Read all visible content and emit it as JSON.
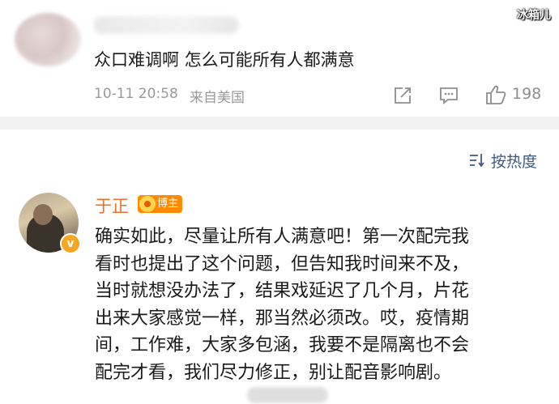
{
  "watermark": {
    "corner_text": "冰箱儿"
  },
  "comment1": {
    "text": "众口难调啊 怎么可能所有人都满意",
    "time": "10-11 20:58",
    "source": "来自美国",
    "like_count": "198"
  },
  "sort": {
    "label": "按热度"
  },
  "reply": {
    "author": "于正",
    "badge": "博主",
    "verified_mark": "v",
    "lines": [
      "确实如此，尽量让所有人满意吧！第一次配完我",
      "看时也提出了这个问题，但告知我时间来不及，",
      "当时就想没办法了，结果戏延迟了几个月，片花",
      "出来大家感觉一样，那当然必须改。哎，疫情期",
      "间，工作难，大家多包涵，我要不是隔离也不会",
      "配完才看，我们尽力修正，别让配音影响剧。"
    ]
  },
  "colors": {
    "author": "#e8702a",
    "link": "#3d5a80",
    "meta": "#9a9a9a",
    "badge": "#ff8a00"
  }
}
